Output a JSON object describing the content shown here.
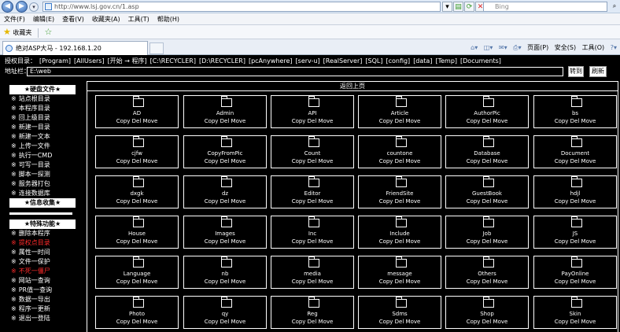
{
  "browser": {
    "url": "http://www.lsj.gov.cn/1.asp",
    "search_placeholder": "Bing",
    "menu": [
      "文件(F)",
      "编辑(E)",
      "查看(V)",
      "收藏夹(A)",
      "工具(T)",
      "帮助(H)"
    ],
    "favorites_label": "收藏夹",
    "tab_title": "绝对ASP大马 - 192.168.1.20",
    "command_bar": [
      "页面(P)",
      "安全(S)",
      "工具(O)"
    ]
  },
  "shell": {
    "quick_label": "授权目录：",
    "quick_links": [
      "[Program]",
      "[AllUsers]",
      "[开始 → 程序]",
      "[C:\\RECYCLER]",
      "[D:\\RECYCLER]",
      "[pcAnywhere]",
      "[serv-u]",
      "[RealServer]",
      "[SQL]",
      "[config]",
      "[data]",
      "[Temp]",
      "[Documents]"
    ],
    "address_label": "地址栏：",
    "address_value": "E:\\web",
    "go_button": "转到",
    "refresh_button": "刷新",
    "up_level": "返回上页",
    "sidebar": {
      "sections": [
        {
          "title": "★硬盘文件★",
          "items": [
            {
              "label": "站点根目录",
              "red": false
            },
            {
              "label": "本程序目录",
              "red": false
            },
            {
              "label": "回上级目录",
              "red": false
            },
            {
              "label": "新建一目录",
              "red": false
            },
            {
              "label": "新建一文本",
              "red": false
            },
            {
              "label": "上传一文件",
              "red": false
            },
            {
              "label": "执行一CMD",
              "red": false
            },
            {
              "label": "可写一目录",
              "red": false
            },
            {
              "label": "脚本一探测",
              "red": false
            },
            {
              "label": "服务器打包",
              "red": false
            },
            {
              "label": "连接数据库",
              "red": false
            }
          ]
        },
        {
          "title": "★信息收集★",
          "items": []
        },
        {
          "title": "★特殊功能★",
          "items": [
            {
              "label": "删除本程序",
              "red": false
            },
            {
              "label": "提权点目录",
              "red": true
            },
            {
              "label": "属性一时间",
              "red": false
            },
            {
              "label": "文件一保护",
              "red": false
            },
            {
              "label": "不死一僵尸",
              "red": true
            },
            {
              "label": "网站一查询",
              "red": false
            },
            {
              "label": "PR值一查询",
              "red": false
            },
            {
              "label": "数据一导出",
              "red": false
            },
            {
              "label": "程序一更新",
              "red": false
            },
            {
              "label": "退出一登陆",
              "red": false
            }
          ]
        }
      ],
      "bullet": "※"
    },
    "file_actions": "Copy Del Move",
    "folders": [
      "AD",
      "Admin",
      "API",
      "Article",
      "AuthorPic",
      "bs",
      "cjfw",
      "CopyFromPic",
      "Count",
      "countone",
      "Database",
      "Document",
      "dxgk",
      "dz",
      "Editor",
      "FriendSite",
      "GuestBook",
      "hdjl",
      "House",
      "Images",
      "Inc",
      "Include",
      "Job",
      "JS",
      "Language",
      "nb",
      "media",
      "message",
      "Others",
      "PayOnline",
      "Photo",
      "qy",
      "Reg",
      "Sdms",
      "Shop",
      "Skin"
    ]
  }
}
